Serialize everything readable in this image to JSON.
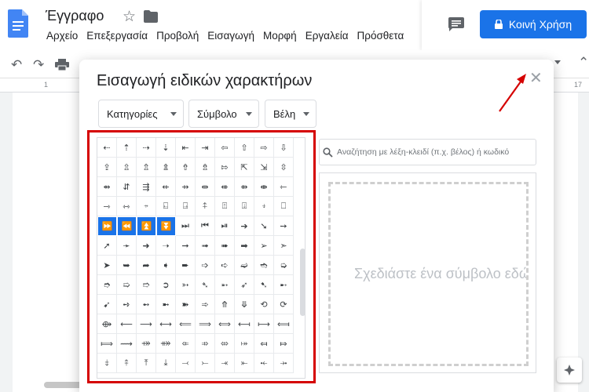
{
  "header": {
    "doc_title": "Έγγραφο",
    "menu": [
      "Αρχείο",
      "Επεξεργασία",
      "Προβολή",
      "Εισαγωγή",
      "Μορφή",
      "Εργαλεία",
      "Πρόσθετα"
    ],
    "share_label": "Κοινή Χρήση"
  },
  "ruler": {
    "left_mark": "1",
    "right_mark": "17"
  },
  "dialog": {
    "title": "Εισαγωγή ειδικών χαρακτήρων",
    "dropdowns": [
      "Κατηγορίες",
      "Σύμβολο",
      "Βέλη"
    ],
    "search_placeholder": "Αναζήτηση με λέξη-κλειδί (π.χ. βέλος) ή κωδικό",
    "draw_hint": "Σχεδιάστε ένα σύμβολο εδώ",
    "symbol_grid": [
      [
        "⇠",
        "⇡",
        "⇢",
        "⇣",
        "⇤",
        "⇥",
        "⇦",
        "⇧",
        "⇨",
        "⇩"
      ],
      [
        "⇪",
        "⇫",
        "⇬",
        "⇭",
        "⇮",
        "⇯",
        "⇰",
        "⇱",
        "⇲",
        "⇳"
      ],
      [
        "⇴",
        "⇵",
        "⇶",
        "⇷",
        "⇸",
        "⇹",
        "⇺",
        "⇻",
        "⇼",
        "⇽"
      ],
      [
        "⇾",
        "⇿",
        "⍆",
        "⍇",
        "⍈",
        "⍏",
        "⍐",
        "⍗",
        "⍖",
        "⎕"
      ],
      [
        "⏩",
        "⏪",
        "⏫",
        "⏬",
        "⏭",
        "⏮",
        "⏯",
        "➔",
        "➘",
        "➙"
      ],
      [
        "➚",
        "➛",
        "➜",
        "➝",
        "➞",
        "➟",
        "➠",
        "➡",
        "➢",
        "➣"
      ],
      [
        "➤",
        "➥",
        "➦",
        "➧",
        "➨",
        "➩",
        "➪",
        "➫",
        "➬",
        "➭"
      ],
      [
        "➮",
        "➯",
        "➱",
        "➲",
        "➳",
        "➴",
        "➵",
        "➶",
        "➷",
        "➸"
      ],
      [
        "➹",
        "➺",
        "➻",
        "➼",
        "➽",
        "➾",
        "⤊",
        "⤋",
        "⟲",
        "⟳"
      ],
      [
        "⟴",
        "⟵",
        "⟶",
        "⟷",
        "⟸",
        "⟹",
        "⟺",
        "⟻",
        "⟼",
        "⟽"
      ],
      [
        "⟾",
        "⟿",
        "⤀",
        "⤁",
        "⤂",
        "⤃",
        "⤄",
        "⤅",
        "⤆",
        "⤇"
      ],
      [
        "⤈",
        "⤉",
        "⤒",
        "⤓",
        "⤙",
        "⤚",
        "⤛",
        "⤜",
        "⤝",
        "⤞"
      ]
    ],
    "highlighted_cells": [
      [
        4,
        0
      ],
      [
        4,
        1
      ],
      [
        4,
        2
      ],
      [
        4,
        3
      ]
    ]
  },
  "colors": {
    "accent": "#1a73e8",
    "annotation": "#d50000"
  }
}
